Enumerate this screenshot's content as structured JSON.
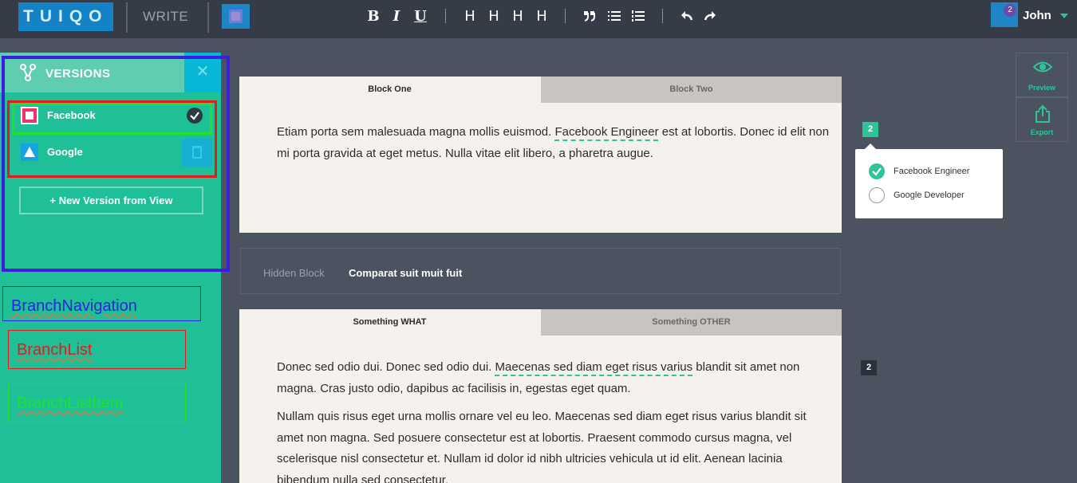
{
  "app": {
    "logo": "TUIQO",
    "mode": "WRITE",
    "user_name": "John",
    "notification_count": "2"
  },
  "toolbar": {
    "bold": "B",
    "italic": "I",
    "underline": "U",
    "headings": [
      "H",
      "H",
      "H",
      "H"
    ]
  },
  "sidebar": {
    "title": "VERSIONS",
    "close_glyph": "✕",
    "versions": [
      {
        "label": "Facebook",
        "selected": true
      },
      {
        "label": "Google",
        "selected": false
      }
    ],
    "new_version_label": "+  New Version from View"
  },
  "annotations": {
    "branch_navigation": "BranchNavigation",
    "branch_list": "BranchList",
    "branch_list_item": "BranchListItem"
  },
  "side_actions": {
    "preview": "Preview",
    "export": "Export"
  },
  "blocks": [
    {
      "tabs": [
        "Block One",
        "Block Two"
      ],
      "para_prefix": "Etiam porta sem malesuada magna mollis euismod. ",
      "para_highlight": "Facebook Engineer",
      "para_suffix": " est at lobortis. Donec id elit non mi porta gravida at eget metus. Nulla vitae elit libero, a pharetra augue.",
      "variant_count": "2"
    },
    {
      "tabs": [
        "Something WHAT",
        "Something OTHER"
      ],
      "para1_prefix": "Donec sed odio dui. Donec sed odio dui. ",
      "para1_highlight": "Maecenas sed diam eget risus varius",
      "para1_suffix": " blandit sit amet non magna. Cras justo odio, dapibus ac facilisis in, egestas eget quam.",
      "para2": "Nullam quis risus eget urna mollis ornare vel eu leo. Maecenas sed diam eget risus varius blandit sit amet non magna. Sed posuere consectetur est at lobortis. Praesent commodo cursus magna, vel scelerisque nisl consectetur et. Nullam id dolor id nibh ultricies vehicula ut id elit. Aenean lacinia bibendum nulla sed consectetur.",
      "variant_count": "2"
    }
  ],
  "hidden_block": {
    "label": "Hidden Block",
    "text": "Comparat suit muit fuit"
  },
  "popover": {
    "options": [
      {
        "label": "Facebook Engineer",
        "checked": true
      },
      {
        "label": "Google Developer",
        "checked": false
      }
    ]
  },
  "colors": {
    "accent": "#2ec49a",
    "sidebar": "#1fbf97",
    "topbar": "#353c48",
    "canvas": "#4b5361",
    "blue": "#1482c7"
  }
}
